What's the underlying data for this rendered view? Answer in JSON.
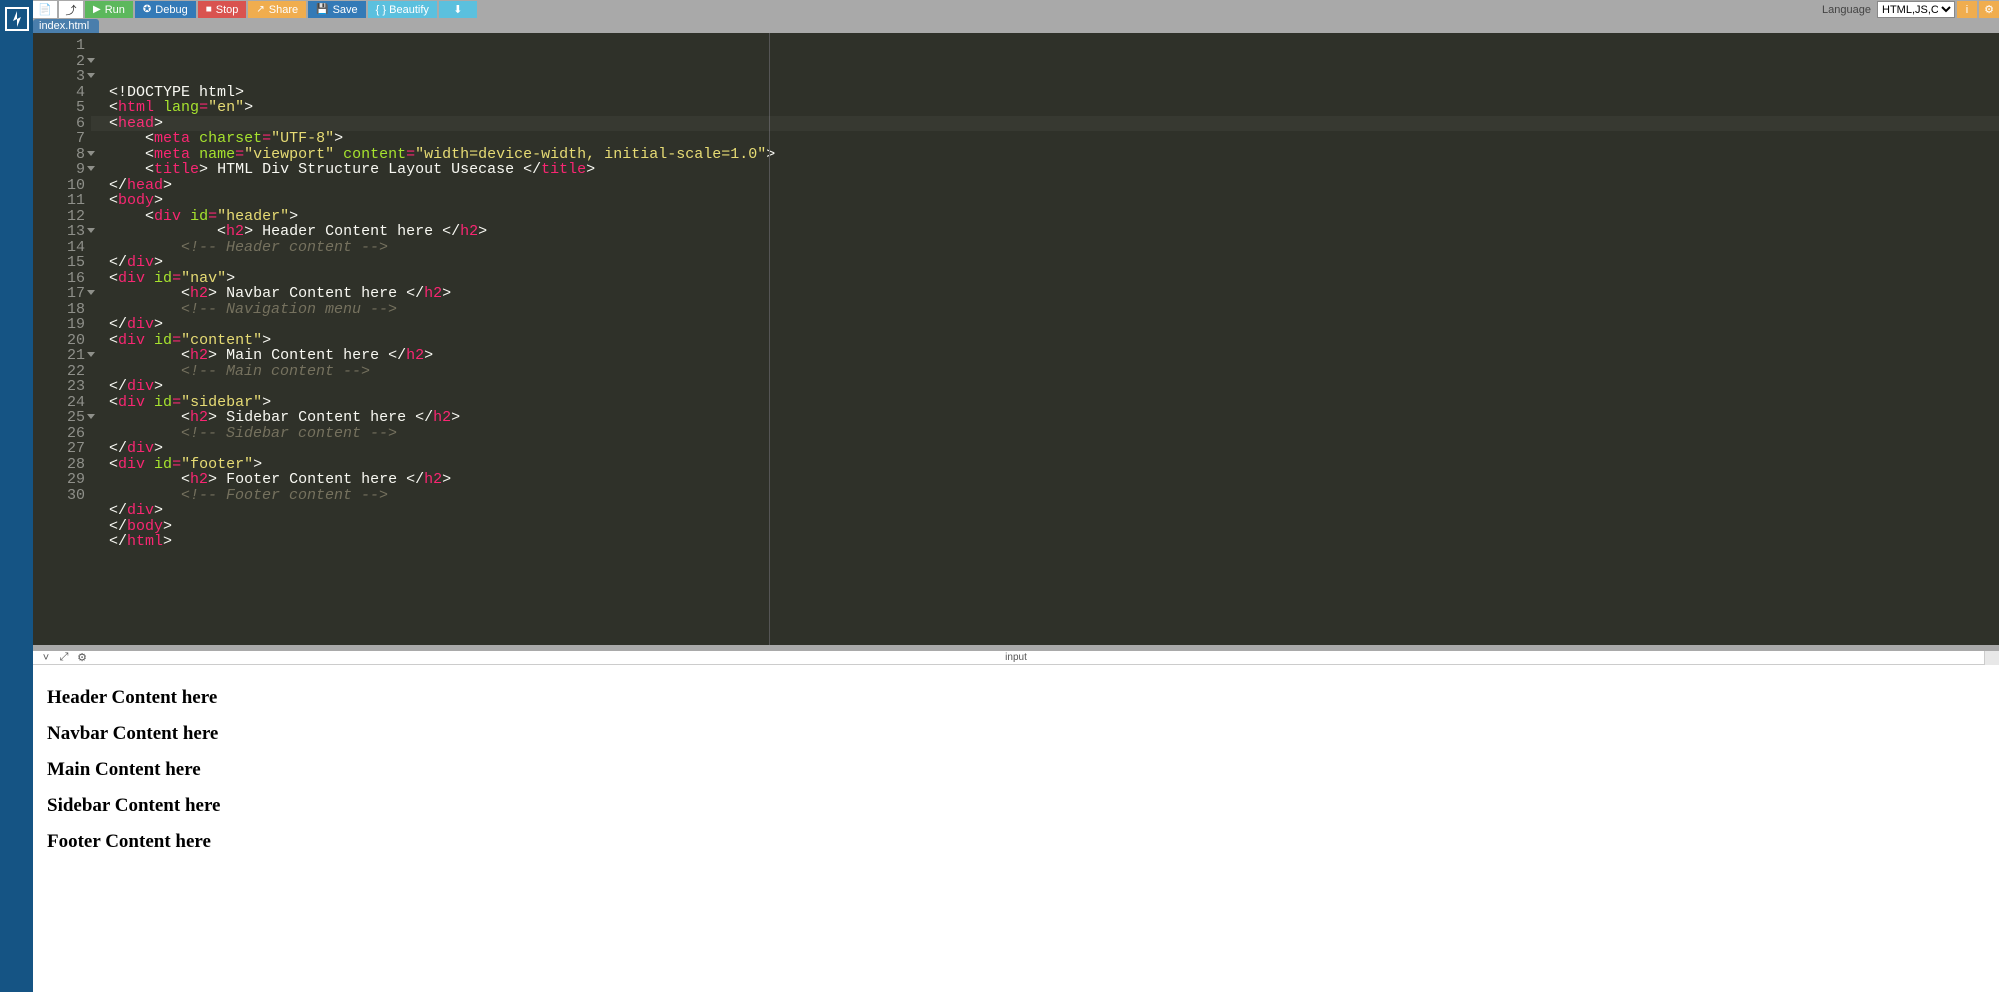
{
  "toolbar": {
    "run": "Run",
    "debug": "Debug",
    "stop": "Stop",
    "share": "Share",
    "save": "Save",
    "beautify": "{ } Beautify",
    "language_label": "Language",
    "language_value": "HTML,JS,CSS"
  },
  "tab": {
    "filename": "index.html"
  },
  "output": {
    "title": "input",
    "h": [
      "Header Content here",
      "Navbar Content here",
      "Main Content here",
      "Sidebar Content here",
      "Footer Content here"
    ]
  },
  "code": {
    "lines": [
      {
        "n": 1,
        "fold": false,
        "ind": 0,
        "seg": [
          {
            "c": "tk-punc",
            "t": "<!"
          },
          {
            "c": "tk-doctype",
            "t": "DOCTYPE html"
          },
          {
            "c": "tk-punc",
            "t": ">"
          }
        ]
      },
      {
        "n": 2,
        "fold": true,
        "ind": 0,
        "seg": [
          {
            "c": "tk-punc",
            "t": "<"
          },
          {
            "c": "tk-tag",
            "t": "html"
          },
          {
            "c": "tk-txt",
            "t": " "
          },
          {
            "c": "tk-attr",
            "t": "lang"
          },
          {
            "c": "tk-op",
            "t": "="
          },
          {
            "c": "tk-str",
            "t": "\"en\""
          },
          {
            "c": "tk-punc",
            "t": ">"
          }
        ]
      },
      {
        "n": 3,
        "fold": true,
        "ind": 0,
        "seg": [
          {
            "c": "tk-punc",
            "t": "<"
          },
          {
            "c": "tk-tag",
            "t": "head"
          },
          {
            "c": "tk-punc",
            "t": ">"
          }
        ]
      },
      {
        "n": 4,
        "fold": false,
        "ind": 1,
        "seg": [
          {
            "c": "tk-punc",
            "t": "<"
          },
          {
            "c": "tk-tag",
            "t": "meta"
          },
          {
            "c": "tk-txt",
            "t": " "
          },
          {
            "c": "tk-attr",
            "t": "charset"
          },
          {
            "c": "tk-op",
            "t": "="
          },
          {
            "c": "tk-str",
            "t": "\"UTF-8\""
          },
          {
            "c": "tk-punc",
            "t": ">"
          }
        ]
      },
      {
        "n": 5,
        "fold": false,
        "ind": 1,
        "seg": [
          {
            "c": "tk-punc",
            "t": "<"
          },
          {
            "c": "tk-tag",
            "t": "meta"
          },
          {
            "c": "tk-txt",
            "t": " "
          },
          {
            "c": "tk-attr",
            "t": "name"
          },
          {
            "c": "tk-op",
            "t": "="
          },
          {
            "c": "tk-str",
            "t": "\"viewport\""
          },
          {
            "c": "tk-txt",
            "t": " "
          },
          {
            "c": "tk-attr",
            "t": "content"
          },
          {
            "c": "tk-op",
            "t": "="
          },
          {
            "c": "tk-str",
            "t": "\"width=device-width, initial-scale=1.0\""
          },
          {
            "c": "tk-punc",
            "t": ">"
          }
        ]
      },
      {
        "n": 6,
        "fold": false,
        "ind": 1,
        "seg": [
          {
            "c": "tk-punc",
            "t": "<"
          },
          {
            "c": "tk-tag",
            "t": "title"
          },
          {
            "c": "tk-punc",
            "t": ">"
          },
          {
            "c": "tk-txt",
            "t": " HTML Div Structure Layout Usecase "
          },
          {
            "c": "tk-punc",
            "t": "</"
          },
          {
            "c": "tk-tag",
            "t": "title"
          },
          {
            "c": "tk-punc",
            "t": ">"
          }
        ]
      },
      {
        "n": 7,
        "fold": false,
        "ind": 0,
        "seg": [
          {
            "c": "tk-punc",
            "t": "</"
          },
          {
            "c": "tk-tag",
            "t": "head"
          },
          {
            "c": "tk-punc",
            "t": ">"
          }
        ]
      },
      {
        "n": 8,
        "fold": true,
        "ind": 0,
        "seg": [
          {
            "c": "tk-punc",
            "t": "<"
          },
          {
            "c": "tk-tag",
            "t": "body"
          },
          {
            "c": "tk-punc",
            "t": ">"
          }
        ]
      },
      {
        "n": 9,
        "fold": true,
        "ind": 1,
        "seg": [
          {
            "c": "tk-punc",
            "t": "<"
          },
          {
            "c": "tk-tag",
            "t": "div"
          },
          {
            "c": "tk-txt",
            "t": " "
          },
          {
            "c": "tk-attr",
            "t": "id"
          },
          {
            "c": "tk-op",
            "t": "="
          },
          {
            "c": "tk-str",
            "t": "\"header\""
          },
          {
            "c": "tk-punc",
            "t": ">"
          }
        ]
      },
      {
        "n": 10,
        "fold": false,
        "ind": 3,
        "seg": [
          {
            "c": "tk-punc",
            "t": "<"
          },
          {
            "c": "tk-tag",
            "t": "h2"
          },
          {
            "c": "tk-punc",
            "t": ">"
          },
          {
            "c": "tk-txt",
            "t": " Header Content here "
          },
          {
            "c": "tk-punc",
            "t": "</"
          },
          {
            "c": "tk-tag",
            "t": "h2"
          },
          {
            "c": "tk-punc",
            "t": ">"
          }
        ]
      },
      {
        "n": 11,
        "fold": false,
        "ind": 2,
        "seg": [
          {
            "c": "tk-cmt",
            "t": "<!-- Header content -->"
          }
        ]
      },
      {
        "n": 12,
        "fold": false,
        "ind": 0,
        "seg": [
          {
            "c": "tk-punc",
            "t": "</"
          },
          {
            "c": "tk-tag",
            "t": "div"
          },
          {
            "c": "tk-punc",
            "t": ">"
          }
        ]
      },
      {
        "n": 13,
        "fold": true,
        "ind": 0,
        "seg": [
          {
            "c": "tk-punc",
            "t": "<"
          },
          {
            "c": "tk-tag",
            "t": "div"
          },
          {
            "c": "tk-txt",
            "t": " "
          },
          {
            "c": "tk-attr",
            "t": "id"
          },
          {
            "c": "tk-op",
            "t": "="
          },
          {
            "c": "tk-str",
            "t": "\"nav\""
          },
          {
            "c": "tk-punc",
            "t": ">"
          }
        ]
      },
      {
        "n": 14,
        "fold": false,
        "ind": 2,
        "seg": [
          {
            "c": "tk-punc",
            "t": "<"
          },
          {
            "c": "tk-tag",
            "t": "h2"
          },
          {
            "c": "tk-punc",
            "t": ">"
          },
          {
            "c": "tk-txt",
            "t": " Navbar Content here "
          },
          {
            "c": "tk-punc",
            "t": "</"
          },
          {
            "c": "tk-tag",
            "t": "h2"
          },
          {
            "c": "tk-punc",
            "t": ">"
          }
        ]
      },
      {
        "n": 15,
        "fold": false,
        "ind": 2,
        "seg": [
          {
            "c": "tk-cmt",
            "t": "<!-- Navigation menu -->"
          }
        ]
      },
      {
        "n": 16,
        "fold": false,
        "ind": 0,
        "seg": [
          {
            "c": "tk-punc",
            "t": "</"
          },
          {
            "c": "tk-tag",
            "t": "div"
          },
          {
            "c": "tk-punc",
            "t": ">"
          }
        ]
      },
      {
        "n": 17,
        "fold": true,
        "ind": 0,
        "seg": [
          {
            "c": "tk-punc",
            "t": "<"
          },
          {
            "c": "tk-tag",
            "t": "div"
          },
          {
            "c": "tk-txt",
            "t": " "
          },
          {
            "c": "tk-attr",
            "t": "id"
          },
          {
            "c": "tk-op",
            "t": "="
          },
          {
            "c": "tk-str",
            "t": "\"content\""
          },
          {
            "c": "tk-punc",
            "t": ">"
          }
        ]
      },
      {
        "n": 18,
        "fold": false,
        "ind": 2,
        "seg": [
          {
            "c": "tk-punc",
            "t": "<"
          },
          {
            "c": "tk-tag",
            "t": "h2"
          },
          {
            "c": "tk-punc",
            "t": ">"
          },
          {
            "c": "tk-txt",
            "t": " Main Content here "
          },
          {
            "c": "tk-punc",
            "t": "</"
          },
          {
            "c": "tk-tag",
            "t": "h2"
          },
          {
            "c": "tk-punc",
            "t": ">"
          }
        ]
      },
      {
        "n": 19,
        "fold": false,
        "ind": 2,
        "seg": [
          {
            "c": "tk-cmt",
            "t": "<!-- Main content -->"
          }
        ]
      },
      {
        "n": 20,
        "fold": false,
        "ind": 0,
        "seg": [
          {
            "c": "tk-punc",
            "t": "</"
          },
          {
            "c": "tk-tag",
            "t": "div"
          },
          {
            "c": "tk-punc",
            "t": ">"
          }
        ]
      },
      {
        "n": 21,
        "fold": true,
        "ind": 0,
        "seg": [
          {
            "c": "tk-punc",
            "t": "<"
          },
          {
            "c": "tk-tag",
            "t": "div"
          },
          {
            "c": "tk-txt",
            "t": " "
          },
          {
            "c": "tk-attr",
            "t": "id"
          },
          {
            "c": "tk-op",
            "t": "="
          },
          {
            "c": "tk-str",
            "t": "\"sidebar\""
          },
          {
            "c": "tk-punc",
            "t": ">"
          }
        ]
      },
      {
        "n": 22,
        "fold": false,
        "ind": 2,
        "seg": [
          {
            "c": "tk-punc",
            "t": "<"
          },
          {
            "c": "tk-tag",
            "t": "h2"
          },
          {
            "c": "tk-punc",
            "t": ">"
          },
          {
            "c": "tk-txt",
            "t": " Sidebar Content here "
          },
          {
            "c": "tk-punc",
            "t": "</"
          },
          {
            "c": "tk-tag",
            "t": "h2"
          },
          {
            "c": "tk-punc",
            "t": ">"
          }
        ]
      },
      {
        "n": 23,
        "fold": false,
        "ind": 2,
        "seg": [
          {
            "c": "tk-cmt",
            "t": "<!-- Sidebar content -->"
          }
        ]
      },
      {
        "n": 24,
        "fold": false,
        "ind": 0,
        "seg": [
          {
            "c": "tk-punc",
            "t": "</"
          },
          {
            "c": "tk-tag",
            "t": "div"
          },
          {
            "c": "tk-punc",
            "t": ">"
          }
        ]
      },
      {
        "n": 25,
        "fold": true,
        "ind": 0,
        "seg": [
          {
            "c": "tk-punc",
            "t": "<"
          },
          {
            "c": "tk-tag",
            "t": "div"
          },
          {
            "c": "tk-txt",
            "t": " "
          },
          {
            "c": "tk-attr",
            "t": "id"
          },
          {
            "c": "tk-op",
            "t": "="
          },
          {
            "c": "tk-str",
            "t": "\"footer\""
          },
          {
            "c": "tk-punc",
            "t": ">"
          }
        ]
      },
      {
        "n": 26,
        "fold": false,
        "ind": 2,
        "seg": [
          {
            "c": "tk-punc",
            "t": "<"
          },
          {
            "c": "tk-tag",
            "t": "h2"
          },
          {
            "c": "tk-punc",
            "t": ">"
          },
          {
            "c": "tk-txt",
            "t": " Footer Content here "
          },
          {
            "c": "tk-punc",
            "t": "</"
          },
          {
            "c": "tk-tag",
            "t": "h2"
          },
          {
            "c": "tk-punc",
            "t": ">"
          }
        ]
      },
      {
        "n": 27,
        "fold": false,
        "ind": 2,
        "seg": [
          {
            "c": "tk-cmt",
            "t": "<!-- Footer content -->"
          }
        ]
      },
      {
        "n": 28,
        "fold": false,
        "ind": 0,
        "seg": [
          {
            "c": "tk-punc",
            "t": "</"
          },
          {
            "c": "tk-tag",
            "t": "div"
          },
          {
            "c": "tk-punc",
            "t": ">"
          }
        ]
      },
      {
        "n": 29,
        "fold": false,
        "ind": 0,
        "seg": [
          {
            "c": "tk-punc",
            "t": "</"
          },
          {
            "c": "tk-tag",
            "t": "body"
          },
          {
            "c": "tk-punc",
            "t": ">"
          }
        ]
      },
      {
        "n": 30,
        "fold": false,
        "ind": 0,
        "seg": [
          {
            "c": "tk-punc",
            "t": "</"
          },
          {
            "c": "tk-tag",
            "t": "html"
          },
          {
            "c": "tk-punc",
            "t": ">"
          }
        ]
      }
    ],
    "active_line": 6
  }
}
